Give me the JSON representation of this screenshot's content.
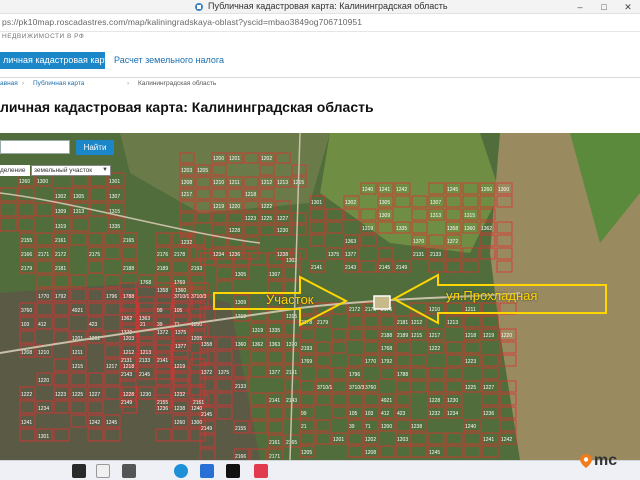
{
  "window": {
    "title": "Публичная кадастровая карта: Калининградская область",
    "url": "ps://pk10map.roscadastres.com/map/kaliningradskaya-oblast?yscid=mbao3849og706710951",
    "controls": {
      "minimize": "–",
      "maximize": "□",
      "close": "✕"
    }
  },
  "header": {
    "org": "НЕДВИЖИМОСТИ В РФ",
    "tab_active": "личная кадастровая карта",
    "tab_link": "Расчет земельного налога"
  },
  "breadcrumb": [
    "авная",
    "Публичная карта",
    "Калининградская область"
  ],
  "page_title": "личная кадастровая карта: Калининградская область",
  "map": {
    "search_button": "Найти",
    "filter_label": "деление",
    "filter_value": "земельный участок",
    "annotation_plot": "Участок",
    "annotation_street": "ул.Прохладная",
    "colors": {
      "annotation": "#ffd600",
      "parcel_border": "#e03030",
      "search_button": "#1b87c8"
    },
    "labels": [
      "1200",
      "1201",
      "1202",
      "1203",
      "1205",
      "1208",
      "1210",
      "1211",
      "1212",
      "1213",
      "1215",
      "1217",
      "1218",
      "1219",
      "1220",
      "1222",
      "1223",
      "1225",
      "1227",
      "1228",
      "1230",
      "1232",
      "1234",
      "1236",
      "1238",
      "1240",
      "1241",
      "1242",
      "1245",
      "1260",
      "1300",
      "1301",
      "1302",
      "1305",
      "1307",
      "1309",
      "1313",
      "1315",
      "1319",
      "1335",
      "1358",
      "1360",
      "1362",
      "1363",
      "1370",
      "1372",
      "1375",
      "1377",
      "2131",
      "2133",
      "2141",
      "2143",
      "2145",
      "2149",
      "2155",
      "2161",
      "2165",
      "2166",
      "2171",
      "2172",
      "2175",
      "2176",
      "2178",
      "2179",
      "2181",
      "2188",
      "2189",
      "2193",
      "1768",
      "1769",
      "1770",
      "1792",
      "1796",
      "1788",
      "3710/1",
      "3710/3",
      "3760",
      "4921",
      "99",
      "105",
      "103",
      "412",
      "423",
      "21",
      "39",
      "71"
    ]
  },
  "taskbar": {
    "icons": [
      "start-icon",
      "search-icon",
      "task-view-icon",
      "edge-icon",
      "store-icon",
      "dev-icon",
      "app-icon"
    ],
    "watermark": "mc"
  }
}
